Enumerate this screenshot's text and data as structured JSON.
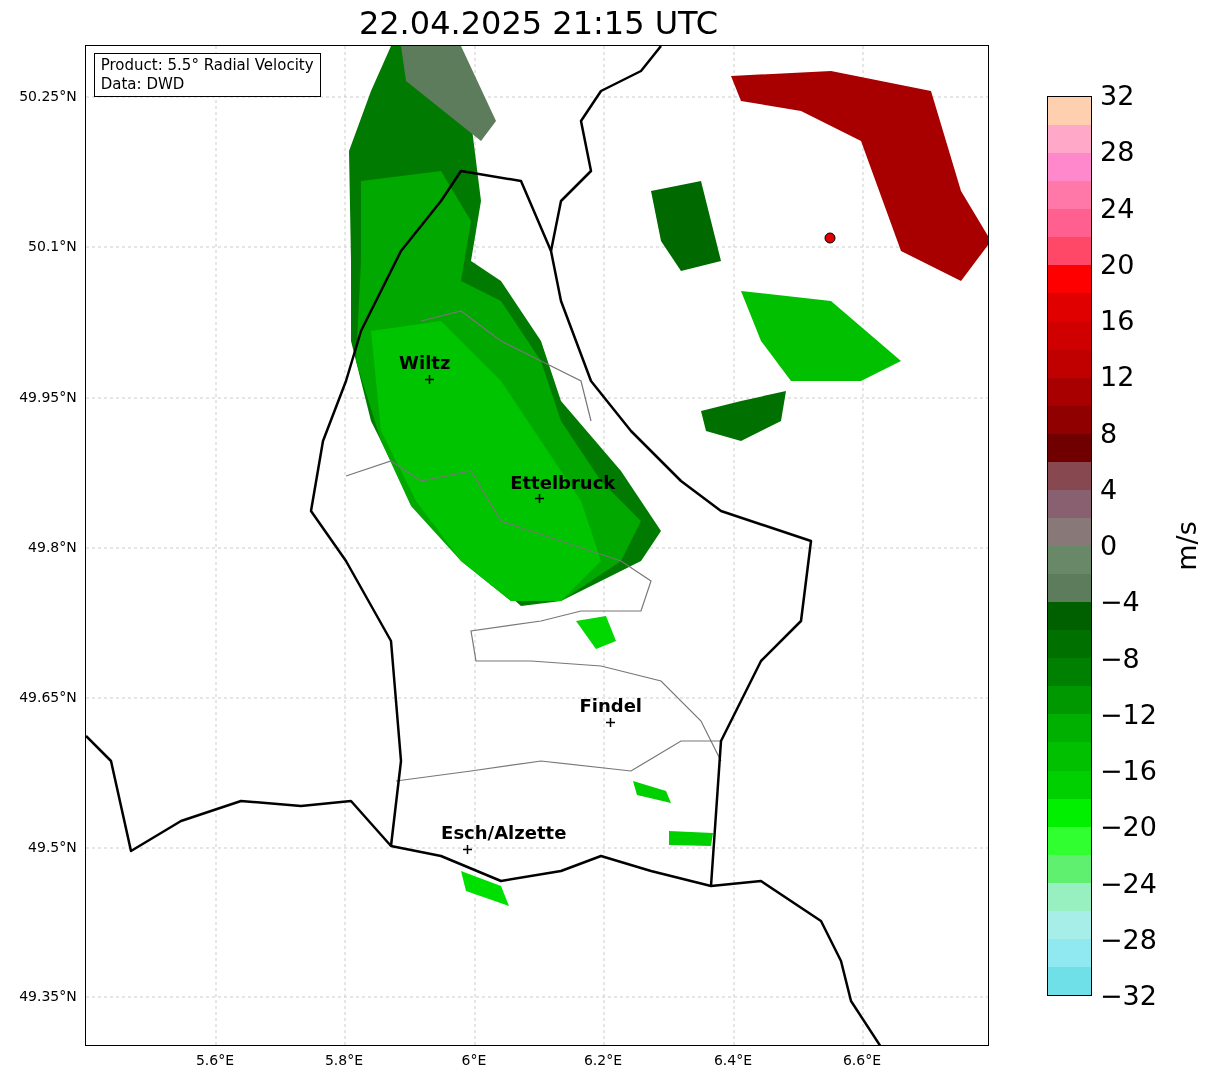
{
  "title": "22.04.2025 21:15 UTC",
  "legend": [
    "Product: 5.5° Radial Velocity",
    "Data: DWD"
  ],
  "y_ticks": [
    "50.25°N",
    "50.1°N",
    "49.95°N",
    "49.8°N",
    "49.65°N",
    "49.5°N",
    "49.35°N"
  ],
  "x_ticks": [
    "5.6°E",
    "5.8°E",
    "6°E",
    "6.2°E",
    "6.4°E",
    "6.6°E"
  ],
  "places": [
    {
      "name": "Wiltz"
    },
    {
      "name": "Ettelbruck"
    },
    {
      "name": "Findel"
    },
    {
      "name": "Esch/Alzette"
    }
  ],
  "colorbar": {
    "label": "m/s",
    "ticks": [
      "32",
      "28",
      "24",
      "20",
      "16",
      "12",
      "8",
      "4",
      "0",
      "−4",
      "−8",
      "−12",
      "−16",
      "−20",
      "−24",
      "−28",
      "−32"
    ],
    "bands": [
      {
        "color": "#ffd0b0"
      },
      {
        "color": "#ffa8c8"
      },
      {
        "color": "#ff88cc"
      },
      {
        "color": "#ff78a8"
      },
      {
        "color": "#ff6090"
      },
      {
        "color": "#ff4868"
      },
      {
        "color": "#ff0000"
      },
      {
        "color": "#e00000"
      },
      {
        "color": "#d00000"
      },
      {
        "color": "#c00000"
      },
      {
        "color": "#a80000"
      },
      {
        "color": "#900000"
      },
      {
        "color": "#700000"
      },
      {
        "color": "#884850"
      },
      {
        "color": "#886070"
      },
      {
        "color": "#887878"
      },
      {
        "color": "#688868"
      },
      {
        "color": "#5c7c5c"
      },
      {
        "color": "#006000"
      },
      {
        "color": "#007000"
      },
      {
        "color": "#008000"
      },
      {
        "color": "#009800"
      },
      {
        "color": "#00b000"
      },
      {
        "color": "#00c000"
      },
      {
        "color": "#00d000"
      },
      {
        "color": "#00f000"
      },
      {
        "color": "#30ff30"
      },
      {
        "color": "#60f070"
      },
      {
        "color": "#98f0c0"
      },
      {
        "color": "#a8eee8"
      },
      {
        "color": "#90e8f0"
      },
      {
        "color": "#70e0e8"
      }
    ]
  }
}
